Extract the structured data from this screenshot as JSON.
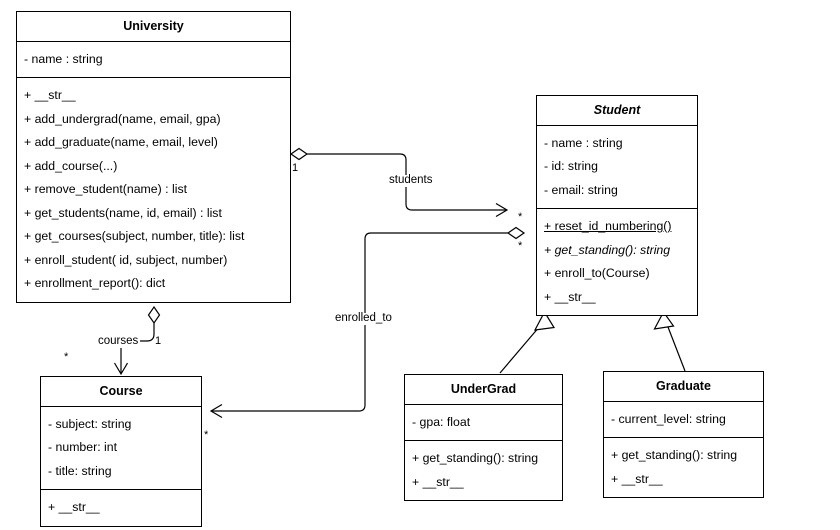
{
  "diagram": {
    "type": "uml-class-diagram",
    "background": "#ffffff",
    "line_color": "#000000"
  },
  "classes": {
    "university": {
      "name": "University",
      "attributes": [
        "- name : string"
      ],
      "methods": [
        "+ __str__",
        "+ add_undergrad(name, email, gpa)",
        "+ add_graduate(name, email, level)",
        "+ add_course(...)",
        "+ remove_student(name) : list",
        "+ get_students(name, id, email) : list",
        "+ get_courses(subject, number, title): list",
        "+ enroll_student( id, subject, number)",
        "+ enrollment_report(): dict"
      ]
    },
    "student": {
      "name": "Student",
      "attributes": [
        "- name : string",
        "- id: string",
        "- email: string"
      ],
      "methods": [
        "+ reset_id_numbering()",
        "+ get_standing(): string",
        "+ enroll_to(Course)",
        "+ __str__"
      ]
    },
    "course": {
      "name": "Course",
      "attributes": [
        "- subject: string",
        "- number: int",
        "- title: string"
      ],
      "methods": [
        "+ __str__"
      ]
    },
    "undergrad": {
      "name": "UnderGrad",
      "attributes": [
        "- gpa: float"
      ],
      "methods": [
        "+ get_standing(): string",
        "+ __str__"
      ]
    },
    "graduate": {
      "name": "Graduate",
      "attributes": [
        "- current_level: string"
      ],
      "methods": [
        "+ get_standing(): string",
        "+ __str__"
      ]
    }
  },
  "relationships": {
    "students": {
      "label": "students",
      "source_multiplicity": "1",
      "target_multiplicity": "*"
    },
    "courses": {
      "label": "courses",
      "source_multiplicity": "1",
      "target_multiplicity": "*"
    },
    "enrolled_to": {
      "label": "enrolled_to",
      "source_multiplicity": "*",
      "target_multiplicity": "*"
    }
  }
}
